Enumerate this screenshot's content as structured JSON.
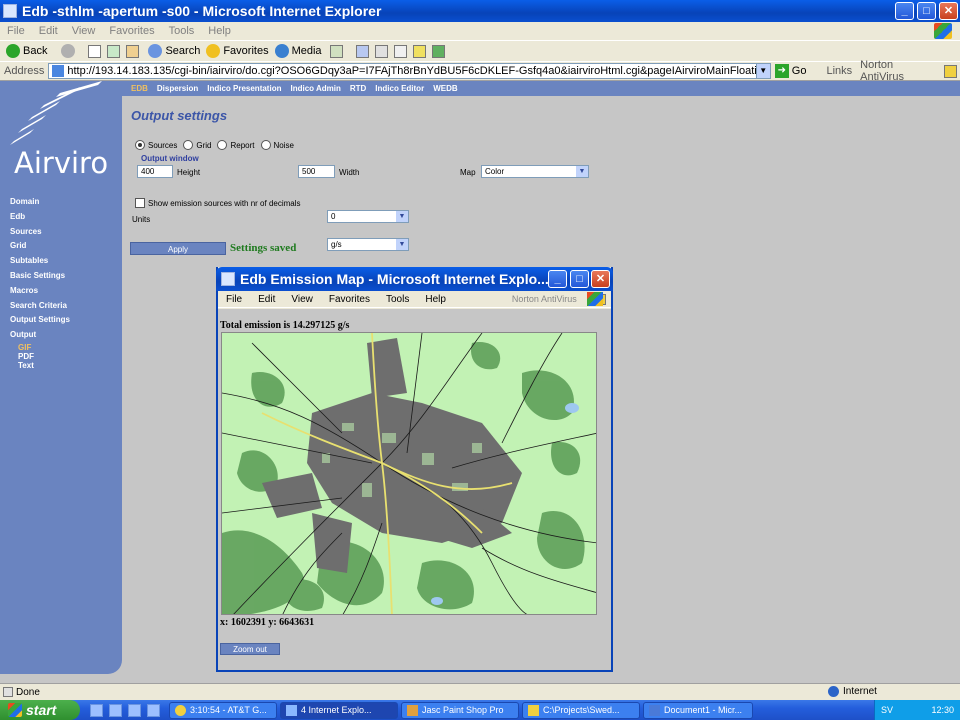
{
  "window": {
    "title": "Edb -sthlm -apertum -s00 - Microsoft Internet Explorer",
    "min_btn": "_",
    "max_btn": "□",
    "close_btn": "✕"
  },
  "menu": [
    "File",
    "Edit",
    "View",
    "Favorites",
    "Tools",
    "Help"
  ],
  "toolbar": {
    "back": "Back",
    "search": "Search",
    "favorites": "Favorites",
    "media": "Media"
  },
  "address": {
    "label": "Address",
    "url": "http://193.14.183.135/cgi-bin/iairviro/do.cgi?OSO6GDqy3aP=I7FAjTh8rBnYdBU5F6cDKLEF-Gsfq4a0&iairviroHtml.cgi&pageIAirviroMainFloatingModule&OSO6GDqy3ai",
    "go": "Go",
    "links": "Links",
    "norton": "Norton AntiVirus"
  },
  "brand": "Airviro",
  "nav": {
    "items": [
      "Domain",
      "Edb",
      "Sources",
      "Grid",
      "Subtables",
      "Basic Settings",
      "Macros",
      "Search Criteria",
      "Output Settings",
      "Output"
    ],
    "subitems": [
      "GIF",
      "PDF",
      "Text"
    ]
  },
  "tabs": [
    "EDB",
    "Dispersion",
    "Indico Presentation",
    "Indico Admin",
    "RTD",
    "Indico Editor",
    "WEDB"
  ],
  "settings": {
    "heading": "Output settings",
    "radios": [
      "Sources",
      "Grid",
      "Report",
      "Noise"
    ],
    "output_window_label": "Output window",
    "height_value": "400",
    "height_label": "Height",
    "width_value": "500",
    "width_label": "Width",
    "map_label": "Map",
    "map_value": "Color",
    "show_emission_label": "Show emission sources with nr of decimals",
    "decimals_value": "0",
    "units_label": "Units",
    "units_value": "g/s",
    "apply_label": "Apply",
    "saved_text": "Settings saved"
  },
  "popup": {
    "title": "Edb Emission Map - Microsoft Internet Explo...",
    "menu": [
      "File",
      "Edit",
      "View",
      "Favorites",
      "Tools",
      "Help"
    ],
    "norton": "Norton AntiVirus",
    "total_text": "Total emission is 14.297125 g/s",
    "coords_text": "x: 1602391 y: 6643631",
    "zoom_out": "Zoom out"
  },
  "status": {
    "left": "Done",
    "zone": "Internet"
  },
  "taskbar": {
    "start": "start",
    "tasks": [
      "3:10:54 - AT&T G...",
      "4 Internet Explo...",
      "Jasc Paint Shop Pro",
      "C:\\Projects\\Swed...",
      "Document1 - Micr..."
    ],
    "lang": "SV",
    "clock": "12:30"
  }
}
